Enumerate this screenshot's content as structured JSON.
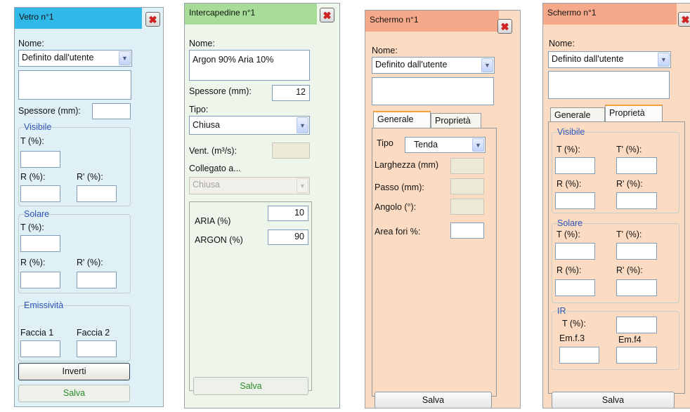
{
  "vetro": {
    "title": "Vetro n°1",
    "nome_label": "Nome:",
    "nome_value": "Definito dall'utente",
    "spessore_label": "Spessore (mm):",
    "visibile_label": "Visibile",
    "t_label": "T (%):",
    "r_label": "R (%):",
    "rp_label": "R' (%):",
    "solare_label": "Solare",
    "emissivita_label": "Emissività",
    "faccia1_label": "Faccia 1",
    "faccia2_label": "Faccia 2",
    "inverti_label": "Inverti",
    "salva_label": "Salva"
  },
  "intercapedine": {
    "title": "Intercapedine n°1",
    "nome_label": "Nome:",
    "nome_value": "Argon 90% Aria 10%",
    "spessore_label": "Spessore (mm):",
    "spessore_value": "12",
    "tipo_label": "Tipo:",
    "tipo_value": "Chiusa",
    "vent_label": "Vent. (m³/s):",
    "collegato_label": "Collegato a...",
    "collegato_value": "Chiusa",
    "aria_label": "ARIA (%)",
    "aria_value": "10",
    "argon_label": "ARGON (%)",
    "argon_value": "90",
    "salva_label": "Salva"
  },
  "schermo_generale": {
    "title": "Schermo n°1",
    "nome_label": "Nome:",
    "nome_value": "Definito dall'utente",
    "tab_generale": "Generale",
    "tab_proprieta": "Proprietà",
    "tipo_label": "Tipo",
    "tipo_value": "Tenda",
    "larghezza_label": "Larghezza (mm)",
    "passo_label": "Passo (mm):",
    "angolo_label": "Angolo (°):",
    "area_label": "Area fori %:",
    "salva_label": "Salva"
  },
  "schermo_proprieta": {
    "title": "Schermo n°1",
    "nome_label": "Nome:",
    "nome_value": "Definito dall'utente",
    "tab_generale": "Generale",
    "tab_proprieta": "Proprietà",
    "visibile_label": "Visibile",
    "solare_label": "Solare",
    "t_label": "T (%):",
    "tp_label": "T' (%):",
    "r_label": "R (%):",
    "rp_label": "R' (%):",
    "ir_label": "IR",
    "ir_t_label": "T (%):",
    "emf3_label": "Em.f.3",
    "emf4_label": "Em.f4",
    "salva_label": "Salva"
  },
  "colors": {
    "vetro_bg": "#dff0f7",
    "vetro_title": "#2fb8e8",
    "intercapedine_bg": "#eef5ea",
    "intercapedine_title": "#a6dc97",
    "schermo_bg": "#fbdcc2",
    "schermo_title": "#f6a98a",
    "group_label": "#2f55b8"
  }
}
